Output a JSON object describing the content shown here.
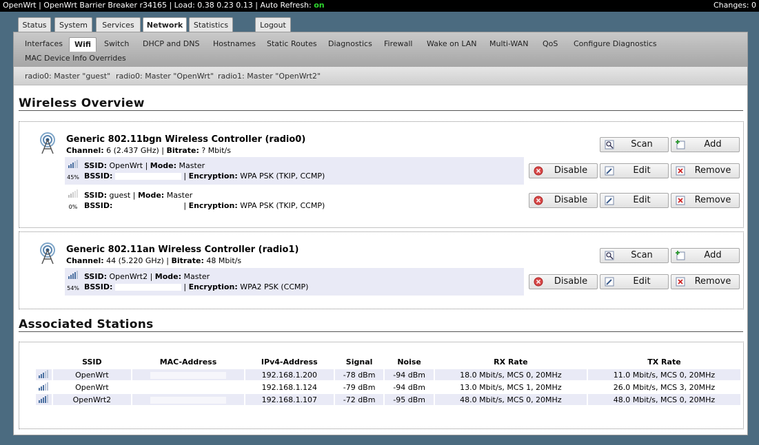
{
  "topbar": {
    "status_text": "OpenWrt | OpenWrt Barrier Breaker r34165 | Load: 0.38 0.23 0.13 | Auto Refresh: ",
    "auto_refresh_state": "on",
    "changes": "Changes: 0",
    "accent_on": "#2ed52e"
  },
  "main_tabs": [
    "Status",
    "System",
    "Services",
    "Network",
    "Statistics",
    "Logout"
  ],
  "main_tab_active": "Network",
  "sub_tabs": [
    "Interfaces",
    "Wifi",
    "Switch",
    "DHCP and DNS",
    "Hostnames",
    "Static Routes",
    "Diagnostics",
    "Firewall",
    "Wake on LAN",
    "Multi-WAN",
    "QoS",
    "Configure Diagnostics",
    "MAC Device Info Overrides"
  ],
  "sub_tab_active": "Wifi",
  "radio_tabs": [
    "radio0: Master \"guest\"",
    "radio0: Master \"OpenWrt\"",
    "radio1: Master \"OpenWrt2\""
  ],
  "overview": {
    "heading": "Wireless Overview",
    "labels": {
      "channel": "Channel:",
      "bitrate": "Bitrate:",
      "ssid": "SSID:",
      "mode": "Mode:",
      "bssid": "BSSID:",
      "encryption": "Encryption:"
    },
    "buttons": {
      "scan": "Scan",
      "add": "Add",
      "disable": "Disable",
      "edit": "Edit",
      "remove": "Remove"
    },
    "controllers": [
      {
        "title": "Generic 802.11bgn Wireless Controller (radio0)",
        "channel": "6 (2.437 GHz)",
        "bitrate": "? Mbit/s",
        "networks": [
          {
            "signal": "45%",
            "ssid": "OpenWrt",
            "mode": "Master",
            "encryption": "WPA PSK (TKIP, CCMP)"
          },
          {
            "signal": "0%",
            "ssid": "guest",
            "mode": "Master",
            "encryption": "WPA PSK (TKIP, CCMP)"
          }
        ]
      },
      {
        "title": "Generic 802.11an Wireless Controller (radio1)",
        "channel": "44 (5.220 GHz)",
        "bitrate": "48 Mbit/s",
        "networks": [
          {
            "signal": "54%",
            "ssid": "OpenWrt2",
            "mode": "Master",
            "encryption": "WPA2 PSK (CCMP)"
          }
        ]
      }
    ]
  },
  "stations": {
    "heading": "Associated Stations",
    "columns": [
      "SSID",
      "MAC-Address",
      "IPv4-Address",
      "Signal",
      "Noise",
      "RX Rate",
      "TX Rate"
    ],
    "rows": [
      {
        "ssid": "OpenWrt",
        "ip": "192.168.1.200",
        "signal": "-78 dBm",
        "noise": "-94 dBm",
        "rx": "18.0 Mbit/s, MCS 0, 20MHz",
        "tx": "11.0 Mbit/s, MCS 0, 20MHz"
      },
      {
        "ssid": "OpenWrt",
        "ip": "192.168.1.124",
        "signal": "-79 dBm",
        "noise": "-94 dBm",
        "rx": "13.0 Mbit/s, MCS 1, 20MHz",
        "tx": "26.0 Mbit/s, MCS 3, 20MHz"
      },
      {
        "ssid": "OpenWrt2",
        "ip": "192.168.1.107",
        "signal": "-72 dBm",
        "noise": "-95 dBm",
        "rx": "48.0 Mbit/s, MCS 0, 20MHz",
        "tx": "48.0 Mbit/s, MCS 0, 20MHz"
      }
    ]
  }
}
